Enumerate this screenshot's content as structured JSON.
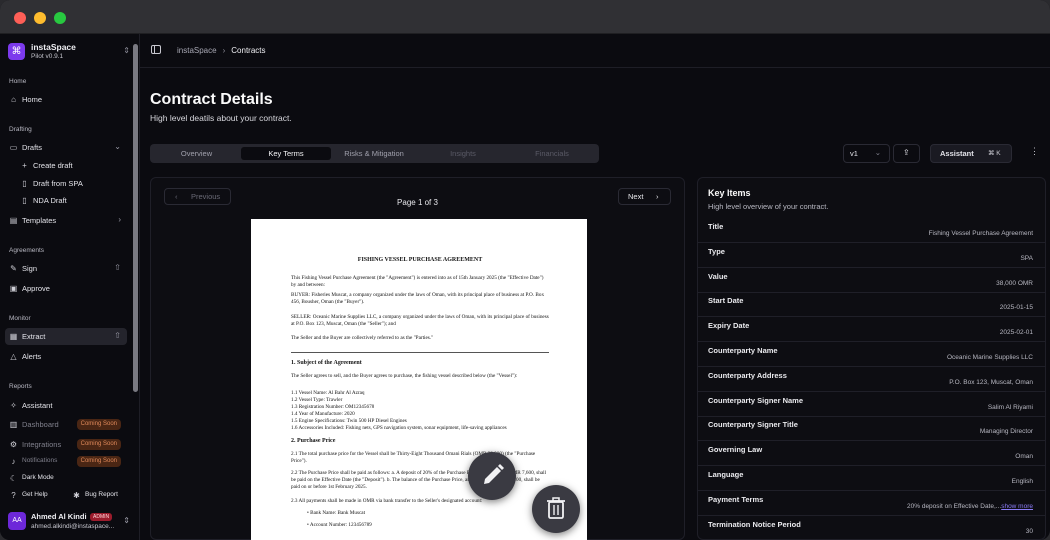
{
  "workspace": {
    "name": "instaSpace",
    "version": "Pilot v0.9.1"
  },
  "sidebar": {
    "sections": [
      "Home",
      "Drafting",
      "Agreements",
      "Monitor",
      "Reports"
    ],
    "home": "Home",
    "drafts": "Drafts",
    "create_draft": "Create draft",
    "draft_from_spa": "Draft from SPA",
    "nda_draft": "NDA Draft",
    "templates": "Templates",
    "sign": "Sign",
    "approve": "Approve",
    "extract": "Extract",
    "alerts": "Alerts",
    "assistant": "Assistant",
    "dashboard": "Dashboard",
    "integrations": "Integrations",
    "notifications": "Notifications",
    "coming_soon": "Coming Soon",
    "dark_mode": "Dark Mode",
    "get_help": "Get Help",
    "bug_report": "Bug Report"
  },
  "user": {
    "name": "Ahmed Al Kindi",
    "role": "ADMIN",
    "email": "ahmed.alkindi@instaspace...",
    "initials": "AA"
  },
  "breadcrumb": {
    "root": "instaSpace",
    "current": "Contracts"
  },
  "page": {
    "title": "Contract Details",
    "subtitle": "High level deatils about your contract."
  },
  "tabs": [
    "Overview",
    "Key Terms",
    "Risks & Mitigation",
    "Insights",
    "Financials"
  ],
  "controls": {
    "version": "v1",
    "assistant": "Assistant",
    "shortcut": "⌘ K"
  },
  "viewer": {
    "previous": "Previous",
    "next": "Next",
    "page": "Page 1 of 3"
  },
  "document": {
    "title": "FISHING VESSEL PURCHASE AGREEMENT",
    "intro": "This Fishing Vessel Purchase Agreement (the \"Agreement\") is entered into as of 15th January 2025 (the \"Effective Date\") by and between:",
    "buyer": "BUYER: Fisheries Muscat, a company organized under the laws of Oman, with its principal place of business at P.O. Box 456, Bousher, Oman (the \"Buyer\").",
    "seller": "SELLER: Oceanic Marine Supplies LLC, a company organized under the laws of Oman, with its principal place of business at P.O. Box 123, Muscat, Oman (the \"Seller\"); and",
    "parties": "The Seller and the Buyer are collectively referred to as the \"Parties.\"",
    "s1": "1. Subject of the Agreement",
    "s1text": "The Seller agrees to sell, and the Buyer agrees to purchase, the fishing vessel described below (the \"Vessel\"):",
    "v1": "1.1 Vessel Name: Al Bahr Al Azraq",
    "v2": "1.2 Vessel Type: Trawler",
    "v3": "1.3 Registration Number: OM12345678",
    "v4": "1.4 Year of Manufacture: 2020",
    "v5": "1.5 Engine Specifications: Twin 500 HP Diesel Engines",
    "v6": "1.6 Accessories Included: Fishing nets, GPS navigation system, sonar equipment, life-saving appliances",
    "s2": "2. Purchase Price",
    "p1": "2.1 The total purchase price for the Vessel shall be Thirty-Eight Thousand Omani Rials (OMR 38,000) (the \"Purchase Price\").",
    "p2": "2.2 The Purchase Price shall be paid as follows: a. A deposit of 20% of the Purchase Price, amounting to OMR 7,600, shall be paid on the Effective Date (the \"Deposit\"). b. The balance of the Purchase Price, amounting to OMR 30,400, shall be paid on or before 1st February 2025.",
    "p3": "2.3 All payments shall be made in OMR via bank transfer to the Seller's designated account:",
    "b1": "Bank Name: Bank Muscat",
    "b2": "Account Number: 123456789"
  },
  "key_items": {
    "title": "Key Items",
    "subtitle": "High level overview of your contract.",
    "rows": [
      {
        "label": "Title",
        "value": "Fishing Vessel Purchase Agreement"
      },
      {
        "label": "Type",
        "value": "SPA"
      },
      {
        "label": "Value",
        "value": "38,000 OMR"
      },
      {
        "label": "Start Date",
        "value": "2025-01-15"
      },
      {
        "label": "Expiry Date",
        "value": "2025-02-01"
      },
      {
        "label": "Counterparty Name",
        "value": "Oceanic Marine Supplies LLC"
      },
      {
        "label": "Counterparty Address",
        "value": "P.O. Box 123, Muscat, Oman"
      },
      {
        "label": "Counterparty Signer Name",
        "value": "Salim Al Riyami"
      },
      {
        "label": "Counterparty Signer Title",
        "value": "Managing Director"
      },
      {
        "label": "Governing Law",
        "value": "Oman"
      },
      {
        "label": "Language",
        "value": "English"
      },
      {
        "label": "Payment Terms",
        "value": "20% deposit on Effective Date,...",
        "more": "show more"
      },
      {
        "label": "Termination Notice Period",
        "value": "30"
      }
    ]
  }
}
